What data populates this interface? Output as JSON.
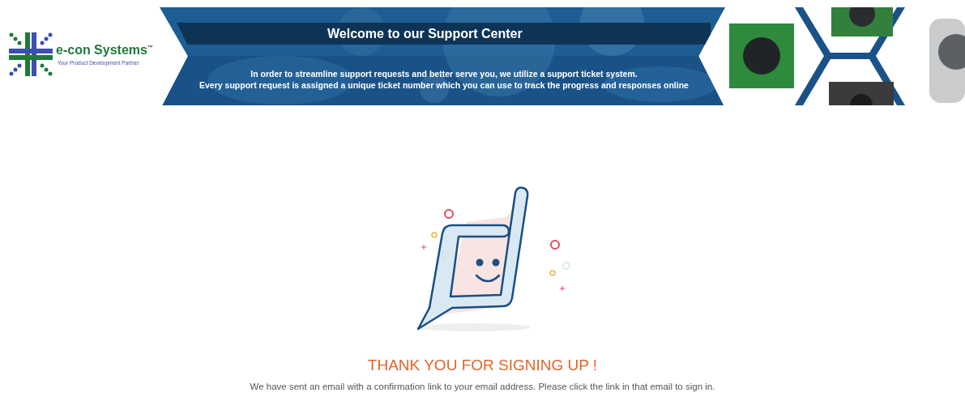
{
  "header": {
    "logo": {
      "name": "e-con Systems$^{™}$",
      "tagline": "Your Product Development Partner"
    },
    "banner": {
      "title": "Welcome to our Support Center",
      "lines": [
        "In order to streamline support requests and better serve you, we utilize a support ticket system.",
        "Every support request is assigned a unique ticket number which you can use to track the progress and responses online"
      ]
    }
  },
  "message": {
    "heading": "THANK YOU FOR SIGNING UP !",
    "text": "We have sent an email with a confirmation link to your email address. Please click the link in that email to sign in."
  }
}
